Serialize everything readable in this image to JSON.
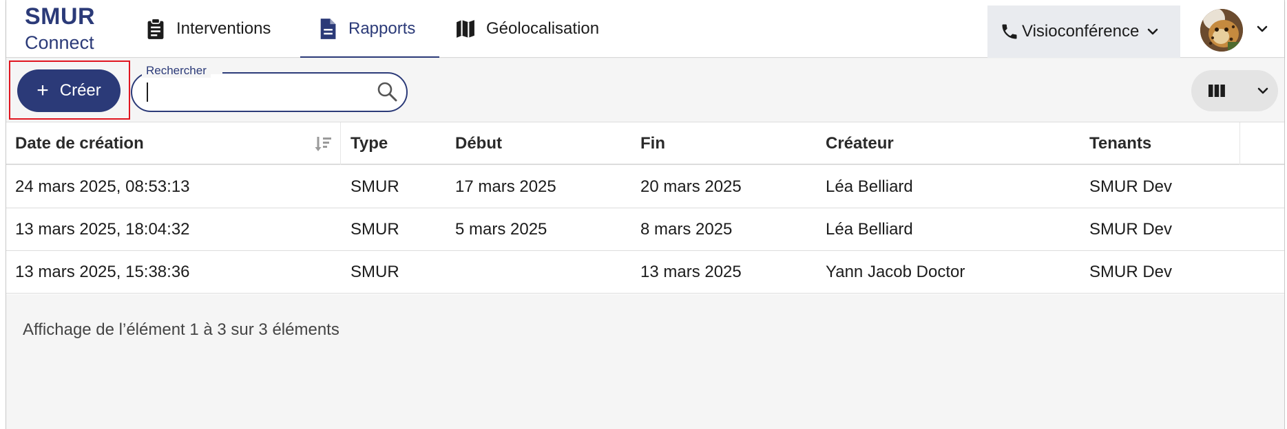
{
  "logo": {
    "line1": "SMUR",
    "line2": "Connect"
  },
  "nav": {
    "tabs": [
      {
        "label": "Interventions",
        "icon": "clipboard-icon"
      },
      {
        "label": "Rapports",
        "icon": "document-icon",
        "active": true
      },
      {
        "label": "Géolocalisation",
        "icon": "map-icon"
      }
    ],
    "visio_label": "Visioconférence"
  },
  "toolbar": {
    "create_label": "Créer",
    "search_label": "Rechercher",
    "search_value": ""
  },
  "table": {
    "columns": [
      "Date de création",
      "Type",
      "Début",
      "Fin",
      "Créateur",
      "Tenants"
    ],
    "rows": [
      [
        "24 mars 2025, 08:53:13",
        "SMUR",
        "17 mars 2025",
        "20 mars 2025",
        "Léa Belliard",
        "SMUR Dev"
      ],
      [
        "13 mars 2025, 18:04:32",
        "SMUR",
        "5 mars 2025",
        "8 mars 2025",
        "Léa Belliard",
        "SMUR Dev"
      ],
      [
        "13 mars 2025, 15:38:36",
        "SMUR",
        "",
        "13 mars 2025",
        "Yann Jacob Doctor",
        "SMUR Dev"
      ]
    ]
  },
  "footer": {
    "summary": "Affichage de l’élément 1 à 3 sur 3 éléments"
  },
  "colors": {
    "brand": "#2b3a78",
    "highlight": "#e0141e"
  }
}
